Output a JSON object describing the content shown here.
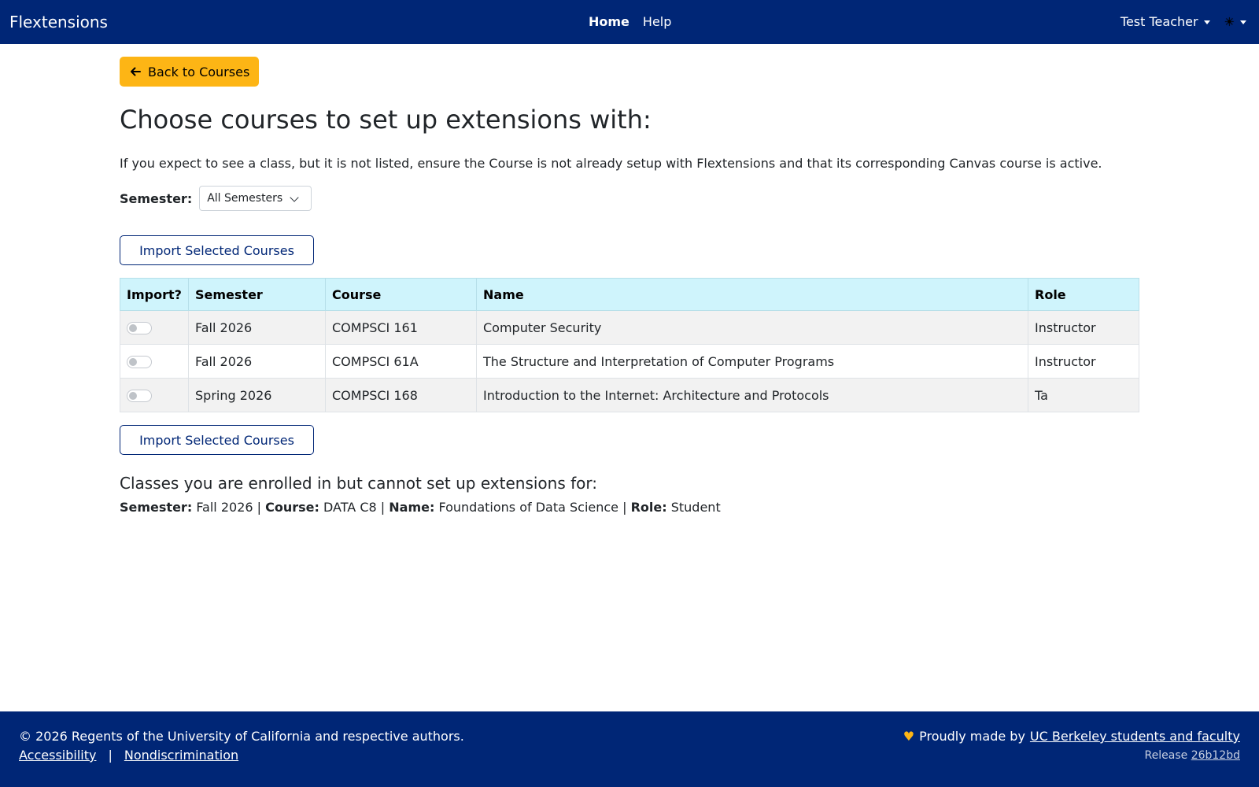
{
  "navbar": {
    "brand": "Flextensions",
    "links": [
      {
        "label": "Home",
        "active": true
      },
      {
        "label": "Help",
        "active": false
      }
    ],
    "user_name": "Test Teacher",
    "theme_icon": "☀"
  },
  "main": {
    "back_label": "Back to Courses",
    "title": "Choose courses to set up extensions with:",
    "info": "If you expect to see a class, but it is not listed, ensure the Course is not already setup with Flextensions and that its corresponding Canvas course is active.",
    "semester_label": "Semester:",
    "semester_value": "All Semesters",
    "import_label": "Import Selected Courses",
    "table": {
      "headers": [
        "Import?",
        "Semester",
        "Course",
        "Name",
        "Role"
      ],
      "rows": [
        {
          "semester": "Fall 2026",
          "course": "COMPSCI 161",
          "name": "Computer Security",
          "role": "Instructor",
          "import": false
        },
        {
          "semester": "Fall 2026",
          "course": "COMPSCI 61A",
          "name": "The Structure and Interpretation of Computer Programs",
          "role": "Instructor",
          "import": false
        },
        {
          "semester": "Spring 2026",
          "course": "COMPSCI 168",
          "name": "Introduction to the Internet: Architecture and Protocols",
          "role": "Ta",
          "import": false
        }
      ]
    },
    "enrolled_title": "Classes you are enrolled in but cannot set up extensions for:",
    "enrolled": {
      "semester_label": "Semester:",
      "semester": "Fall 2026",
      "course_label": "Course:",
      "course": "DATA C8",
      "name_label": "Name:",
      "name": "Foundations of Data Science",
      "role_label": "Role:",
      "role": "Student",
      "separator": "|"
    }
  },
  "footer": {
    "copyright": "© 2026 Regents of the University of California and respective authors.",
    "links": [
      "Accessibility",
      "Nondiscrimination"
    ],
    "link_separator": "|",
    "made_by_prefix": "Proudly made by",
    "made_by_link": "UC Berkeley students and faculty",
    "release_label": "Release",
    "release_hash": "26b12bd"
  },
  "colors": {
    "navy": "#002676",
    "gold": "#FDB515",
    "table_header": "#cff4fc"
  }
}
